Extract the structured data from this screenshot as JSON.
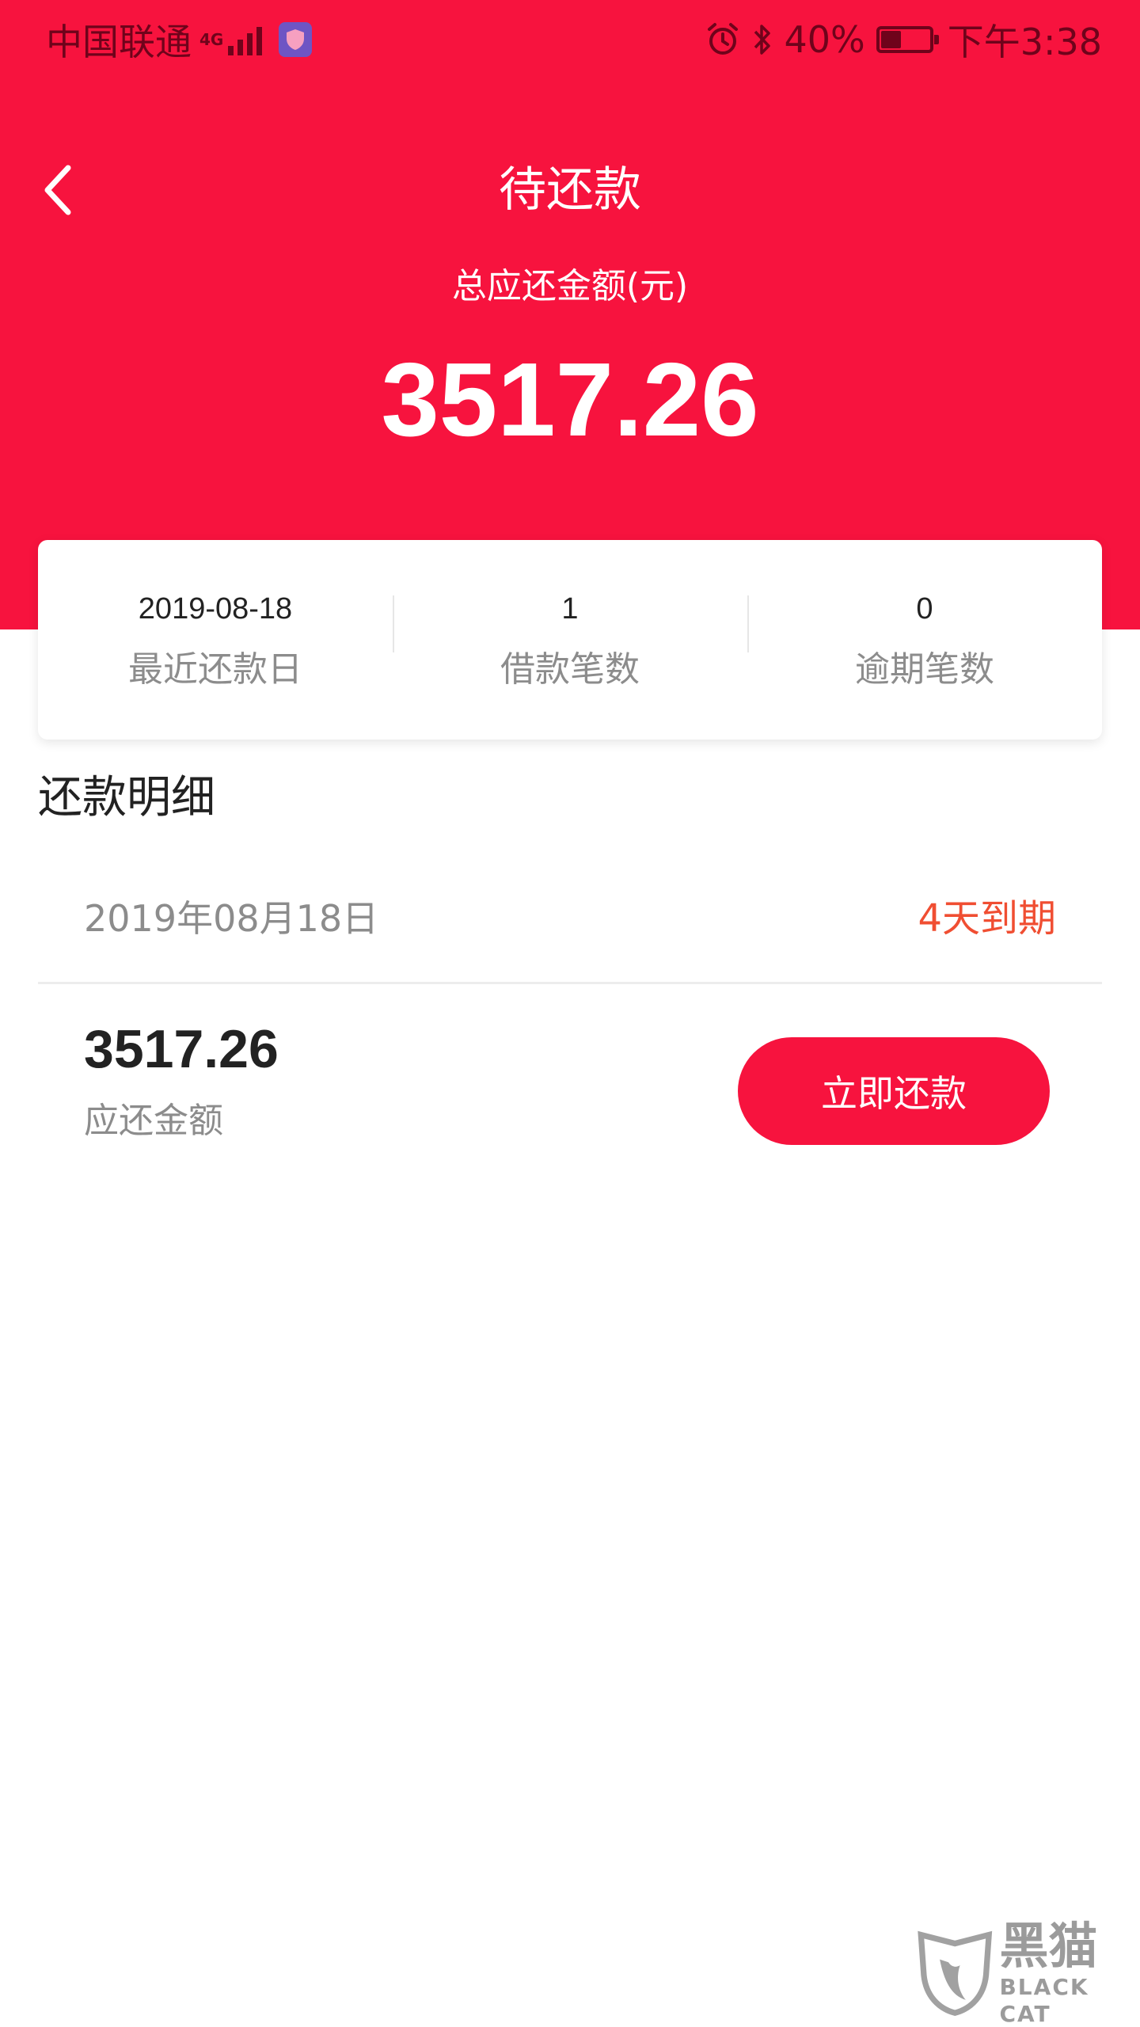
{
  "status_bar": {
    "carrier": "中国联通",
    "network": "4G",
    "battery_percent": "40%",
    "battery_level": 0.4,
    "time": "下午3:38",
    "icons": [
      "signal-icon",
      "security-app-icon",
      "alarm-icon",
      "bluetooth-icon",
      "battery-icon"
    ]
  },
  "header": {
    "title": "待还款",
    "total_label": "总应还金额(元)",
    "total_amount": "3517.26",
    "accent_color": "#f7133e"
  },
  "summary": [
    {
      "value": "2019-08-18",
      "label": "最近还款日"
    },
    {
      "value": "1",
      "label": "借款笔数"
    },
    {
      "value": "0",
      "label": "逾期笔数"
    }
  ],
  "details": {
    "section_title": "还款明细",
    "date": "2019年08月18日",
    "due_status": "4天到期",
    "amount": "3517.26",
    "amount_label": "应还金额",
    "repay_button": "立即还款",
    "due_color": "#f04e32"
  },
  "watermark": {
    "cn": "黑猫",
    "en": "BLACK CAT"
  }
}
